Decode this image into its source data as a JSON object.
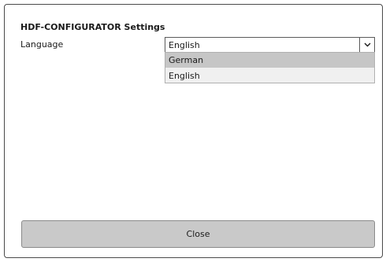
{
  "dialog": {
    "title": "HDF-CONFIGURATOR Settings",
    "language_label": "Language",
    "language_select": {
      "selected": "English",
      "icon": "chevron-down-icon",
      "options": [
        "German",
        "English"
      ],
      "highlighted_option": "German"
    },
    "close_label": "Close"
  }
}
